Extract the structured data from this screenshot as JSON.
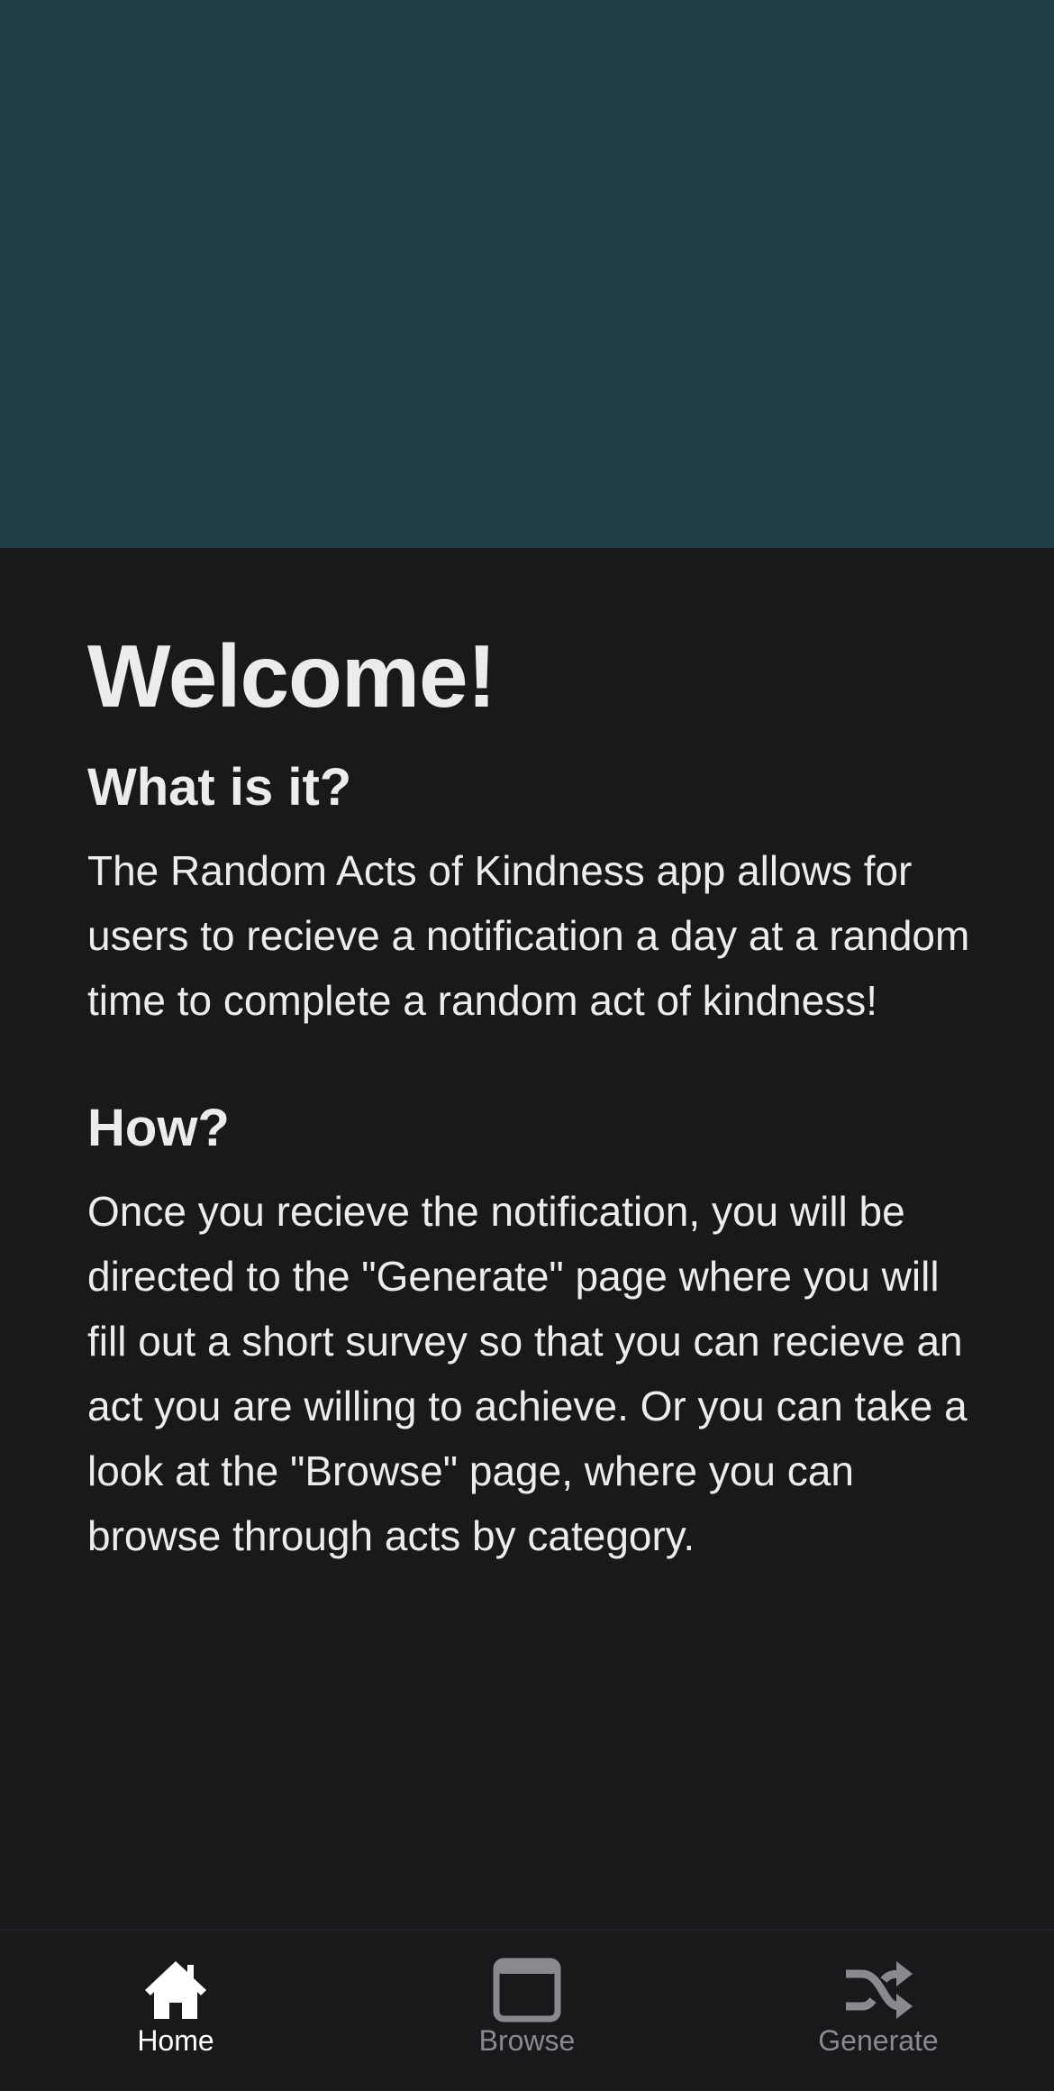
{
  "page": {
    "title": "Welcome!",
    "sections": [
      {
        "heading": "What is it?",
        "body": "The Random Acts of Kindness app allows for users to recieve a notification a day at a random time to complete a random act of kindness!"
      },
      {
        "heading": "How?",
        "body": "Once you recieve the notification, you will be directed to the \"Generate\" page where you will fill out a short survey so that you can recieve an act you are willing to achieve. Or you can take a look at the \"Browse\" page, where you can browse through acts by category."
      }
    ]
  },
  "tab_bar": {
    "tabs": [
      {
        "label": "Home",
        "icon": "home-icon",
        "active": true
      },
      {
        "label": "Browse",
        "icon": "browser-window-icon",
        "active": false
      },
      {
        "label": "Generate",
        "icon": "shuffle-icon",
        "active": false
      }
    ]
  },
  "colors": {
    "banner": "#1f3d47",
    "background": "#19191b",
    "text": "#ececee",
    "tab_active": "#ffffff",
    "tab_inactive": "#8a8a8e"
  }
}
